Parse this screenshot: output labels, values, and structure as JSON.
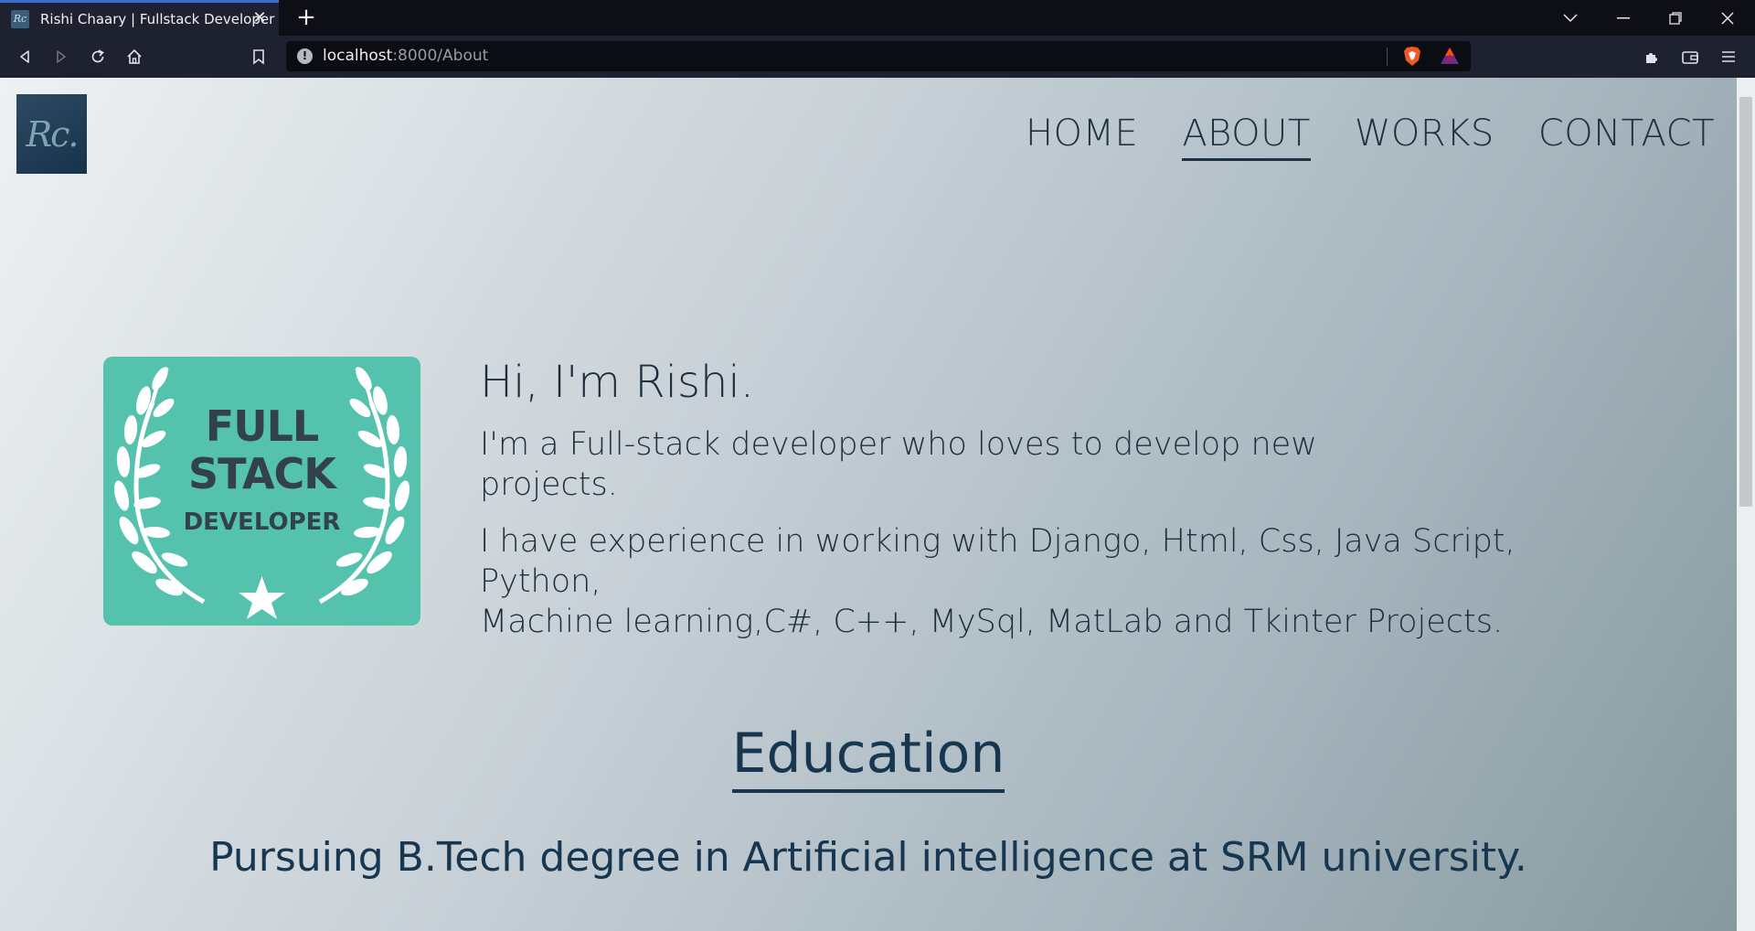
{
  "browser": {
    "tab_title": "Rishi Chaary | Fullstack Developer",
    "tab_favicon_text": "Rc",
    "close_glyph": "✕",
    "new_tab_glyph": "+",
    "url_host": "localhost",
    "url_rest": ":8000/About",
    "icons": [
      "back-icon",
      "forward-icon",
      "reload-icon",
      "home-icon",
      "bookmark-icon",
      "info-icon",
      "brave-shields-icon",
      "bat-rewards-icon",
      "extensions-icon",
      "wallet-icon",
      "menu-icon",
      "tab-search-icon",
      "minimize-icon",
      "restore-icon",
      "close-icon"
    ]
  },
  "site": {
    "logo_text": "Rc.",
    "nav": [
      {
        "label": "HOME"
      },
      {
        "label": "ABOUT",
        "active": true
      },
      {
        "label": "WORKS"
      },
      {
        "label": "CONTACT"
      }
    ],
    "hero_badge": {
      "line1": "FULL",
      "line2": "STACK",
      "line3": "DEVELOPER"
    },
    "greeting": "Hi, I'm Rishi.",
    "intro_1": "I'm a Full-stack developer who loves to develop new projects.",
    "intro_2a": "I have experience in working with Django, Html, Css, Java Script, Python,",
    "intro_2b": "Machine learning,C#, C++, MySql, MatLab and Tkinter Projects.",
    "education_heading": "Education",
    "education_text": "Pursuing B.Tech degree in Artificial intelligence at SRM university."
  },
  "colors": {
    "accent": "#17364f",
    "badge_bg": "#55c2ad",
    "tab_accent": "#3b6fd4"
  }
}
